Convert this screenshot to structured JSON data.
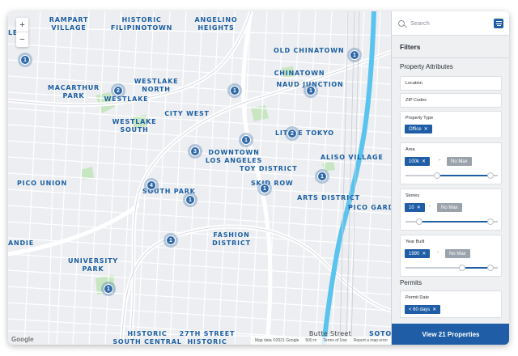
{
  "map": {
    "zoom_in": "+",
    "zoom_out": "−",
    "google_logo": "Google",
    "attribution": [
      "Map data ©2021 Google",
      "500 m",
      "Terms of Use",
      "Report a map error"
    ],
    "neighborhoods": [
      {
        "name": "RAMPART\nVILLAGE"
      },
      {
        "name": "HISTORIC\nFILIPINOTOWN"
      },
      {
        "name": "ANGELINO\nHEIGHTS"
      },
      {
        "name": "OLD CHINATOWN"
      },
      {
        "name": "CHINATOWN"
      },
      {
        "name": "NAUD JUNCTION"
      },
      {
        "name": "MACARTHUR\nPARK"
      },
      {
        "name": "WESTLAKE\nNORTH"
      },
      {
        "name": "WESTLAKE"
      },
      {
        "name": "CITY WEST"
      },
      {
        "name": "WESTLAKE\nSOUTH"
      },
      {
        "name": "LITTLE TOKYO"
      },
      {
        "name": "DOWNTOWN\nLOS ANGELES"
      },
      {
        "name": "ALISO VILLAGE"
      },
      {
        "name": "TOY DISTRICT"
      },
      {
        "name": "PICO UNION"
      },
      {
        "name": "SOUTH PARK"
      },
      {
        "name": "SKID ROW"
      },
      {
        "name": "ARTS DISTRICT"
      },
      {
        "name": "PICO GARD"
      },
      {
        "name": "FASHION\nDISTRICT"
      },
      {
        "name": "ANDIE"
      },
      {
        "name": "UNIVERSITY\nPARK"
      },
      {
        "name": "HISTORIC\nSOUTH CENTRAL"
      },
      {
        "name": "27TH STREET\nHISTORIC"
      },
      {
        "name": "Butte Street"
      },
      {
        "name": "SOTO"
      },
      {
        "name": "LE"
      }
    ],
    "markers": [
      "1",
      "1",
      "2",
      "1",
      "1",
      "2",
      "1",
      "3",
      "1",
      "4",
      "1",
      "1",
      "1",
      "1"
    ]
  },
  "panel": {
    "search_placeholder": "Search",
    "filters_title": "Filters",
    "property_attributes_title": "Property Attributes",
    "location_label": "Location",
    "zip_label": "ZIP Codes",
    "property_type": {
      "label": "Property Type",
      "chip": "Office"
    },
    "area": {
      "label": "Area",
      "min": "100k",
      "max": "No Max",
      "range_fraction": [
        0.33,
        0.95
      ]
    },
    "stories": {
      "label": "Stories",
      "min": "10",
      "max": "No Max",
      "range_fraction": [
        0.12,
        0.95
      ]
    },
    "year_built": {
      "label": "Year Built",
      "min": "1990",
      "max": "No Max",
      "range_fraction": [
        0.62,
        0.95
      ]
    },
    "permits_title": "Permits",
    "permit_date": {
      "label": "Permit Date",
      "chip": "< 60 days"
    },
    "cta": "View 21 Properties"
  },
  "colors": {
    "accent": "#1f5ea6",
    "label": "#1d5fa3",
    "river": "#5bc4ee",
    "park": "#c7e6c1"
  }
}
